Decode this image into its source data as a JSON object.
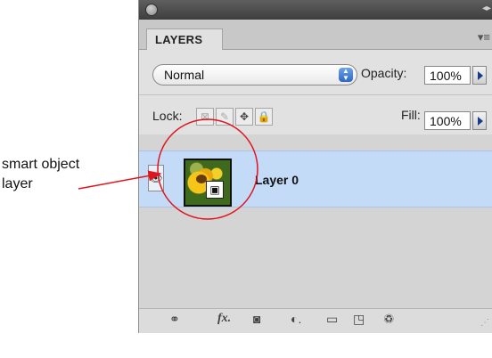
{
  "callout": {
    "line1": "smart object",
    "line2": "layer"
  },
  "panel": {
    "tab_label": "LAYERS",
    "close_icon": "circle-close-icon",
    "collapse_icon": "double-arrow-icon",
    "menu_icon": "panel-menu-icon",
    "blend_mode": "Normal",
    "opacity_label": "Opacity:",
    "opacity_value": "100%",
    "lock_label": "Lock:",
    "lock_icons": [
      "lock-transparency-icon",
      "lock-pixels-icon",
      "lock-position-icon",
      "lock-all-icon"
    ],
    "fill_label": "Fill:",
    "fill_value": "100%"
  },
  "layers": [
    {
      "name": "Layer 0",
      "visible": true,
      "smart_object": true,
      "selected": true
    }
  ],
  "bottom_toolbar": {
    "fx_label": "fx",
    "icons": [
      "link-layers-icon",
      "layer-style-icon",
      "layer-mask-icon",
      "adjustment-layer-icon",
      "new-group-icon",
      "new-layer-icon",
      "trash-icon"
    ]
  },
  "colors": {
    "selected_row": "#c4dbf7",
    "annotation": "#e0141e",
    "panel_bg": "#d6d6d6"
  }
}
